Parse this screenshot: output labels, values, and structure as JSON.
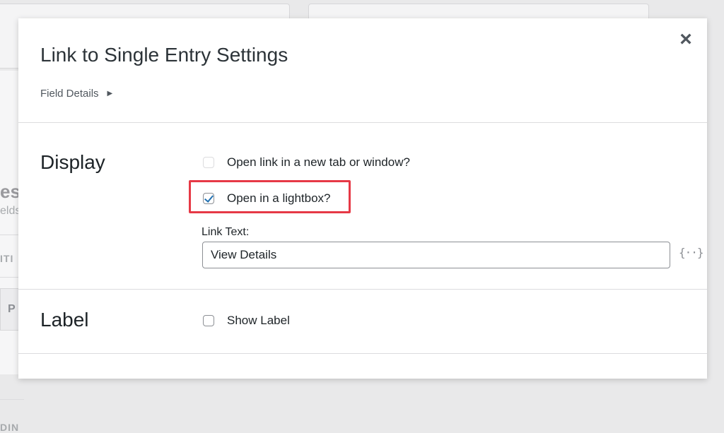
{
  "background": {
    "heading_fragment": "es",
    "sub_fragment": "elds",
    "caption1_fragment": "ITI",
    "button_fragment": "P",
    "caption2_fragment": "DIN"
  },
  "modal": {
    "title": "Link to Single Entry Settings",
    "close_icon": "×",
    "field_details": {
      "label": "Field Details",
      "arrow": "▶"
    },
    "display_section": {
      "heading": "Display",
      "options": [
        {
          "label": "Open link in a new tab or window?",
          "checked": false,
          "disabled": true
        },
        {
          "label": "Open in a lightbox?",
          "checked": true,
          "highlighted": true
        }
      ],
      "link_text": {
        "label": "Link Text:",
        "value": "View Details"
      },
      "merge_tag_icon": "{··}"
    },
    "label_section": {
      "heading": "Label",
      "options": [
        {
          "label": "Show Label",
          "checked": false
        }
      ]
    }
  },
  "colors": {
    "highlight": "#e63946",
    "checkmark": "#2271b1"
  }
}
